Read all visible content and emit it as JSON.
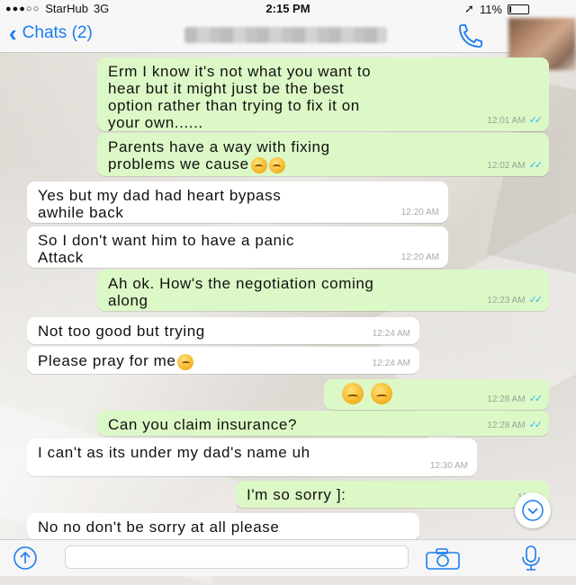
{
  "status_bar": {
    "carrier": "StarHub",
    "network": "3G",
    "time": "2:15 PM",
    "battery": "11%",
    "battery_level": 0.11
  },
  "nav": {
    "back_label": "Chats (2)"
  },
  "colors": {
    "outgoing_bubble": "#dcf8c6",
    "incoming_bubble": "#ffffff",
    "ios_blue": "#1a7cf0",
    "read_ticks": "#34b7f1"
  },
  "messages": [
    {
      "dir": "out",
      "text": "Erm I know it's not what you want to\nhear but it might just be the best\noption rather than trying to fix it on\nyour own......",
      "time": "12:01 AM",
      "ticks": true
    },
    {
      "dir": "out",
      "text": "Parents have a way with fixing\nproblems we cause",
      "emoji": 2,
      "time": "12:02 AM",
      "ticks": true
    },
    {
      "dir": "in",
      "text": "Yes but my dad had heart bypass\nawhile back",
      "time": "12:20 AM"
    },
    {
      "dir": "in",
      "text": "So I don't want him to have a panic\nAttack",
      "time": "12:20 AM"
    },
    {
      "dir": "out",
      "text": "Ah ok. How's the negotiation coming\nalong",
      "time": "12:23 AM",
      "ticks": true
    },
    {
      "dir": "in",
      "text": "Not too good but trying",
      "time": "12:24 AM"
    },
    {
      "dir": "in",
      "text": "Please pray for me",
      "emoji": 1,
      "time": "12:24 AM"
    },
    {
      "dir": "out",
      "text": "",
      "emoji": 2,
      "time": "12:28 AM",
      "ticks": true
    },
    {
      "dir": "out",
      "text": "Can you claim insurance?",
      "time": "12:28 AM",
      "ticks": true
    },
    {
      "dir": "in",
      "text": "I can't as its under my dad's name uh",
      "time": "12:30 AM"
    },
    {
      "dir": "out",
      "text": "I'm so sorry ]:",
      "time": "12:30",
      "ticks": false
    },
    {
      "dir": "in",
      "text": "No no don't be sorry at all please",
      "time": ""
    }
  ]
}
